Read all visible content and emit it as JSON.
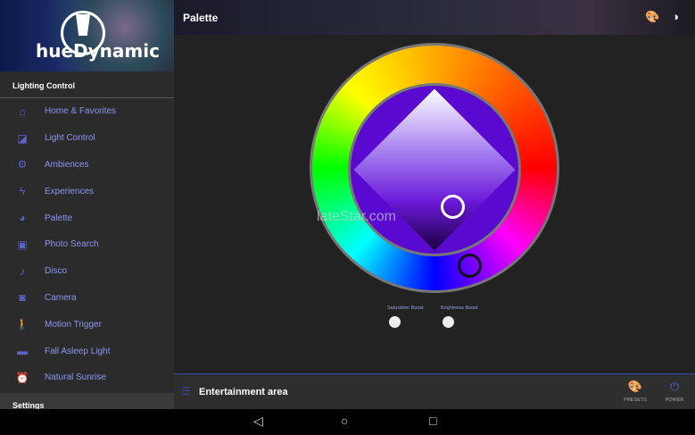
{
  "app": {
    "logo_text": "hueDynamic"
  },
  "sidebar": {
    "section": "Lighting Control",
    "items": [
      {
        "label": "Home & Favorites",
        "icon": "home-icon"
      },
      {
        "label": "Light Control",
        "icon": "light-control-icon"
      },
      {
        "label": "Ambiences",
        "icon": "gear-icon"
      },
      {
        "label": "Experiences",
        "icon": "bolt-icon"
      },
      {
        "label": "Palette",
        "icon": "palette-icon"
      },
      {
        "label": "Photo Search",
        "icon": "image-icon"
      },
      {
        "label": "Disco",
        "icon": "music-note-icon"
      },
      {
        "label": "Camera",
        "icon": "camera-icon"
      },
      {
        "label": "Motion Trigger",
        "icon": "walking-icon"
      },
      {
        "label": "Fall Asleep Light",
        "icon": "bed-icon"
      },
      {
        "label": "Natural Sunrise",
        "icon": "alarm-icon"
      }
    ],
    "settings": "Settings"
  },
  "header": {
    "title": "Palette"
  },
  "picker": {
    "saturation_label": "Saturation Boost",
    "brightness_label": "Brightness Boost",
    "watermark": "lateStar.com"
  },
  "bottom": {
    "area": "Entertainment area",
    "presets": "PRESETS",
    "power": "POWER"
  },
  "colors": {
    "accent": "#5b63c8",
    "inner": "#5a0ad0"
  }
}
